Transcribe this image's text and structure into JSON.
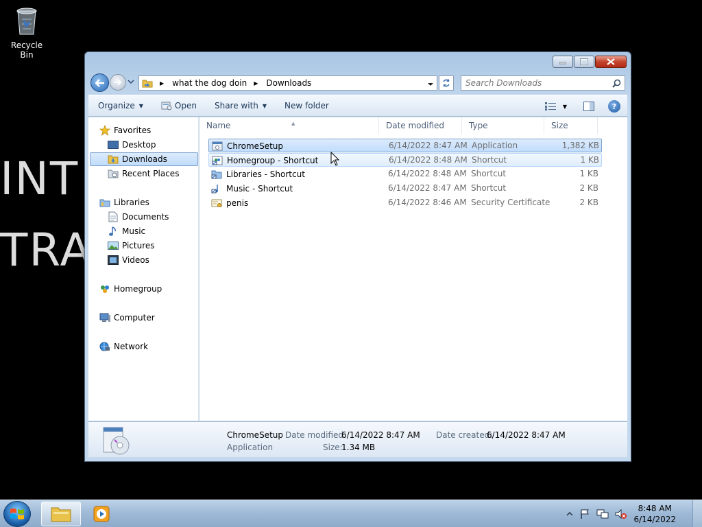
{
  "desktop": {
    "recycle_bin_label": "Recycle Bin",
    "wallpaper_line1": "INT",
    "wallpaper_line2": "TRA"
  },
  "window": {
    "breadcrumbs": [
      "what the dog doin",
      "Downloads"
    ],
    "search_placeholder": "Search Downloads"
  },
  "toolbar": {
    "organize": "Organize",
    "open": "Open",
    "share_with": "Share with",
    "new_folder": "New folder"
  },
  "nav": {
    "favorites": "Favorites",
    "desktop": "Desktop",
    "downloads": "Downloads",
    "recent_places": "Recent Places",
    "libraries": "Libraries",
    "documents": "Documents",
    "music": "Music",
    "pictures": "Pictures",
    "videos": "Videos",
    "homegroup": "Homegroup",
    "computer": "Computer",
    "network": "Network"
  },
  "columns": {
    "name": "Name",
    "date_modified": "Date modified",
    "type": "Type",
    "size": "Size"
  },
  "files": [
    {
      "name": "ChromeSetup",
      "date": "6/14/2022 8:47 AM",
      "type": "Application",
      "size": "1,382 KB",
      "icon": "application-icon"
    },
    {
      "name": "Homegroup - Shortcut",
      "date": "6/14/2022 8:48 AM",
      "type": "Shortcut",
      "size": "1 KB",
      "icon": "homegroup-shortcut-icon"
    },
    {
      "name": "Libraries - Shortcut",
      "date": "6/14/2022 8:48 AM",
      "type": "Shortcut",
      "size": "1 KB",
      "icon": "libraries-shortcut-icon"
    },
    {
      "name": "Music - Shortcut",
      "date": "6/14/2022 8:47 AM",
      "type": "Shortcut",
      "size": "2 KB",
      "icon": "music-shortcut-icon"
    },
    {
      "name": "penis",
      "date": "6/14/2022 8:46 AM",
      "type": "Security Certificate",
      "size": "2 KB",
      "icon": "certificate-icon"
    }
  ],
  "details": {
    "name": "ChromeSetup",
    "type": "Application",
    "date_modified_label": "Date modified:",
    "date_modified": "6/14/2022 8:47 AM",
    "date_created_label": "Date created:",
    "date_created": "6/14/2022 8:47 AM",
    "size_label": "Size:",
    "size": "1.34 MB"
  },
  "taskbar": {
    "time": "8:48 AM",
    "date": "6/14/2022"
  }
}
